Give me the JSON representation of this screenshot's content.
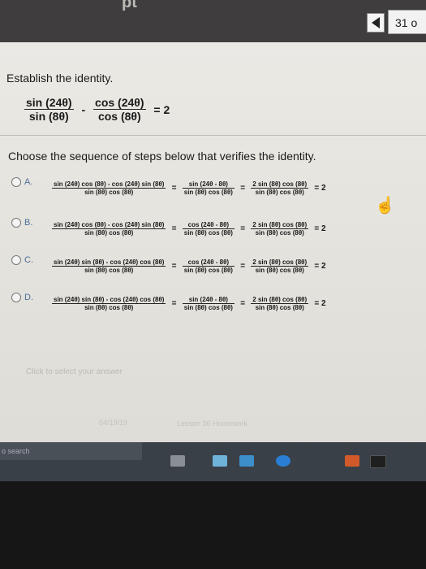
{
  "header": {
    "partial_title": "pt",
    "counter": "31 o"
  },
  "question": {
    "prompt": "Establish the identity.",
    "identity": {
      "left_num": "sin (24θ)",
      "left_den": "sin (8θ)",
      "op": "-",
      "right_num": "cos (24θ)",
      "right_den": "cos (8θ)",
      "rhs": "= 2"
    }
  },
  "choose_text": "Choose the sequence of steps below that verifies the identity.",
  "options": [
    {
      "letter": "A.",
      "f1n": "sin (24θ) cos (8θ) - cos (24θ) sin (8θ)",
      "f1d": "sin (8θ) cos (8θ)",
      "f2n": "sin (24θ - 8θ)",
      "f2d": "sin (8θ) cos (8θ)",
      "f3n": "2 sin (8θ) cos (8θ)",
      "f3d": "sin (8θ) cos (8θ)",
      "end": "= 2"
    },
    {
      "letter": "B.",
      "f1n": "sin (24θ) cos (8θ) - cos (24θ) sin (8θ)",
      "f1d": "sin (8θ) cos (8θ)",
      "f2n": "cos (24θ - 8θ)",
      "f2d": "sin (8θ) cos (8θ)",
      "f3n": "2 sin (8θ) cos (8θ)",
      "f3d": "sin (8θ) cos (8θ)",
      "end": "= 2"
    },
    {
      "letter": "C.",
      "f1n": "sin (24θ) sin (8θ) - cos (24θ) cos (8θ)",
      "f1d": "sin (8θ) cos (8θ)",
      "f2n": "cos (24θ - 8θ)",
      "f2d": "sin (8θ) cos (8θ)",
      "f3n": "2 sin (8θ) cos (8θ)",
      "f3d": "sin (8θ) cos (8θ)",
      "end": "= 2"
    },
    {
      "letter": "D.",
      "f1n": "sin (24θ) sin (8θ) - cos (24θ) cos (8θ)",
      "f1d": "sin (8θ) cos (8θ)",
      "f2n": "sin (24θ - 8θ)",
      "f2d": "sin (8θ) cos (8θ)",
      "f3n": "2 sin (8θ) cos (8θ)",
      "f3d": "sin (8θ) cos (8θ)",
      "end": "= 2"
    }
  ],
  "eq_sign": "=",
  "hint": "Click to select your answer",
  "footer": {
    "date": "04/19/19",
    "lesson": "Lesson 36 Homework"
  },
  "taskbar": {
    "search": "o search"
  },
  "colors": {
    "topbar": "#3f3d3e",
    "taskbar": "#3a4048",
    "accent": "#4a6e9a"
  }
}
